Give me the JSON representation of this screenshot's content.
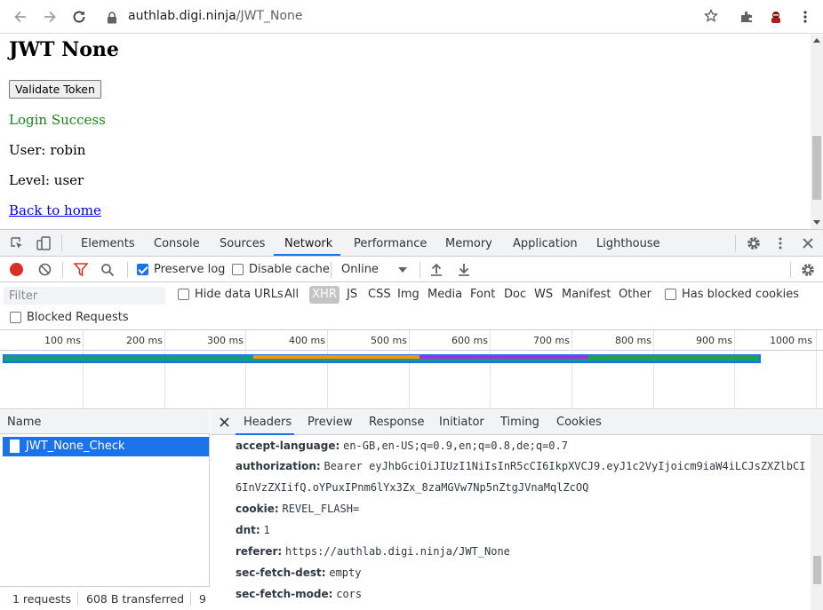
{
  "browser": {
    "url_host": "authlab.digi.ninja",
    "url_path": "/JWT_None",
    "icons": [
      "back-arrow-icon",
      "forward-arrow-icon",
      "reload-icon",
      "lock-icon",
      "star-icon",
      "puzzle-icon",
      "ninja-avatar-icon",
      "kebab-menu-icon"
    ]
  },
  "page": {
    "title": "JWT None",
    "validate_button": "Validate Token",
    "login_status": "Login Success",
    "user_line": "User: robin",
    "level_line": "Level: user",
    "back_link": "Back to home"
  },
  "devtools": {
    "tabs": [
      "Elements",
      "Console",
      "Sources",
      "Network",
      "Performance",
      "Memory",
      "Application",
      "Lighthouse"
    ],
    "active_tab": "Network",
    "toolbar": {
      "preserve_log": "Preserve log",
      "preserve_log_checked": true,
      "disable_cache": "Disable cache",
      "disable_cache_checked": false,
      "throttle": "Online"
    },
    "filter": {
      "placeholder": "Filter",
      "hide_data_urls": "Hide data URLs",
      "types": [
        "All",
        "XHR",
        "JS",
        "CSS",
        "Img",
        "Media",
        "Font",
        "Doc",
        "WS",
        "Manifest",
        "Other"
      ],
      "active_type": "XHR",
      "has_blocked_cookies": "Has blocked cookies",
      "blocked_requests": "Blocked Requests"
    },
    "timeline_ticks": [
      "100 ms",
      "200 ms",
      "300 ms",
      "400 ms",
      "500 ms",
      "600 ms",
      "700 ms",
      "800 ms",
      "900 ms",
      "1000 ms"
    ],
    "colors": {
      "accent": "#1a73e8",
      "bar_teal": "#159a8a",
      "bar_orange": "#f29900",
      "bar_purple": "#9334e6",
      "bar_green": "#1ea446"
    },
    "name_column": {
      "header": "Name",
      "requests": [
        {
          "name": "JWT_None_Check",
          "selected": true
        }
      ]
    },
    "status": {
      "requests": "1 requests",
      "transferred": "608 B transferred",
      "more": "9"
    },
    "detail_tabs": [
      "Headers",
      "Preview",
      "Response",
      "Initiator",
      "Timing",
      "Cookies"
    ],
    "active_detail_tab": "Headers",
    "headers": [
      {
        "key": "accept-language:",
        "value": "en-GB,en-US;q=0.9,en;q=0.8,de;q=0.7"
      },
      {
        "key": "authorization:",
        "value": "Bearer eyJhbGciOiJIUzI1NiIsInR5cCI6IkpXVCJ9.eyJ1c2VyIjoicm9iaW4iLCJsZXZlbCI",
        "value_cont": "6InVzZXIifQ.oYPuxIPnm6lYx3Zx_8zaMGVw7Np5nZtgJVnaMqlZcOQ"
      },
      {
        "key": "cookie:",
        "value": "REVEL_FLASH="
      },
      {
        "key": "dnt:",
        "value": "1"
      },
      {
        "key": "referer:",
        "value": "https://authlab.digi.ninja/JWT_None"
      },
      {
        "key": "sec-fetch-dest:",
        "value": "empty"
      },
      {
        "key": "sec-fetch-mode:",
        "value": "cors"
      }
    ]
  }
}
